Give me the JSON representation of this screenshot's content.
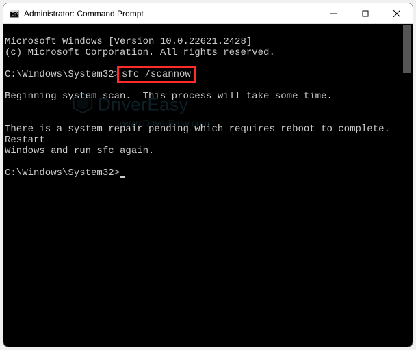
{
  "window": {
    "title": "Administrator: Command Prompt"
  },
  "terminal": {
    "line1": "Microsoft Windows [Version 10.0.22621.2428]",
    "line2": "(c) Microsoft Corporation. All rights reserved.",
    "prompt1_prefix": "C:\\Windows\\System32>",
    "command1": "sfc /scannow",
    "scan_start": "Beginning system scan.  This process will take some time.",
    "repair_msg": "There is a system repair pending which requires reboot to complete.   Restart",
    "repair_msg2": "Windows and run sfc again.",
    "prompt2": "C:\\Windows\\System32>"
  },
  "watermark": {
    "brand": "DriverEasy",
    "url": "www.DriverEasy.com"
  }
}
